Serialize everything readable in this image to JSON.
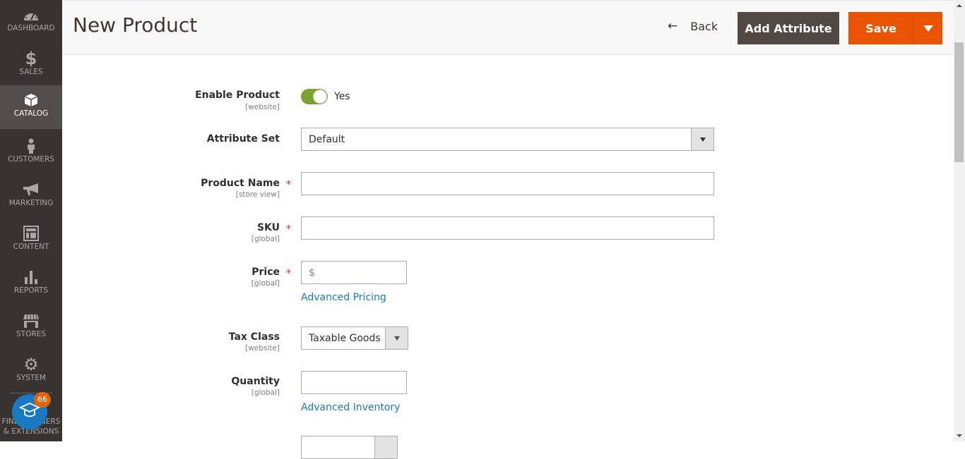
{
  "sidebar": {
    "items": [
      {
        "label": "DASHBOARD",
        "icon": "dashboard-icon"
      },
      {
        "label": "SALES",
        "icon": "dollar-icon"
      },
      {
        "label": "CATALOG",
        "icon": "box-icon",
        "active": true
      },
      {
        "label": "CUSTOMERS",
        "icon": "person-icon"
      },
      {
        "label": "MARKETING",
        "icon": "megaphone-icon"
      },
      {
        "label": "CONTENT",
        "icon": "layout-icon"
      },
      {
        "label": "REPORTS",
        "icon": "bar-chart-icon"
      },
      {
        "label": "STORES",
        "icon": "storefront-icon"
      },
      {
        "label": "SYSTEM",
        "icon": "gear-icon"
      }
    ],
    "partners": {
      "label_line1": "FIND PARTNERS",
      "label_line2": "& EXTENSIONS",
      "badge": "66"
    }
  },
  "header": {
    "title": "New Product",
    "back_label": "Back",
    "add_attribute_label": "Add Attribute",
    "save_label": "Save"
  },
  "form": {
    "enable_product": {
      "label": "Enable Product",
      "scope": "[website]",
      "value": "Yes",
      "enabled": true
    },
    "attribute_set": {
      "label": "Attribute Set",
      "value": "Default"
    },
    "product_name": {
      "label": "Product Name",
      "scope": "[store view]",
      "required": "*",
      "value": ""
    },
    "sku": {
      "label": "SKU",
      "scope": "[global]",
      "required": "*",
      "value": ""
    },
    "price": {
      "label": "Price",
      "scope": "[global]",
      "required": "*",
      "currency": "$",
      "value": "",
      "link": "Advanced Pricing"
    },
    "tax_class": {
      "label": "Tax Class",
      "scope": "[website]",
      "value": "Taxable Goods"
    },
    "quantity": {
      "label": "Quantity",
      "scope": "[global]",
      "value": "",
      "link": "Advanced Inventory"
    }
  },
  "colors": {
    "accent": "#eb5202",
    "sidebar": "#373330",
    "link": "#1979c3",
    "toggle_on": "#79a22e"
  }
}
